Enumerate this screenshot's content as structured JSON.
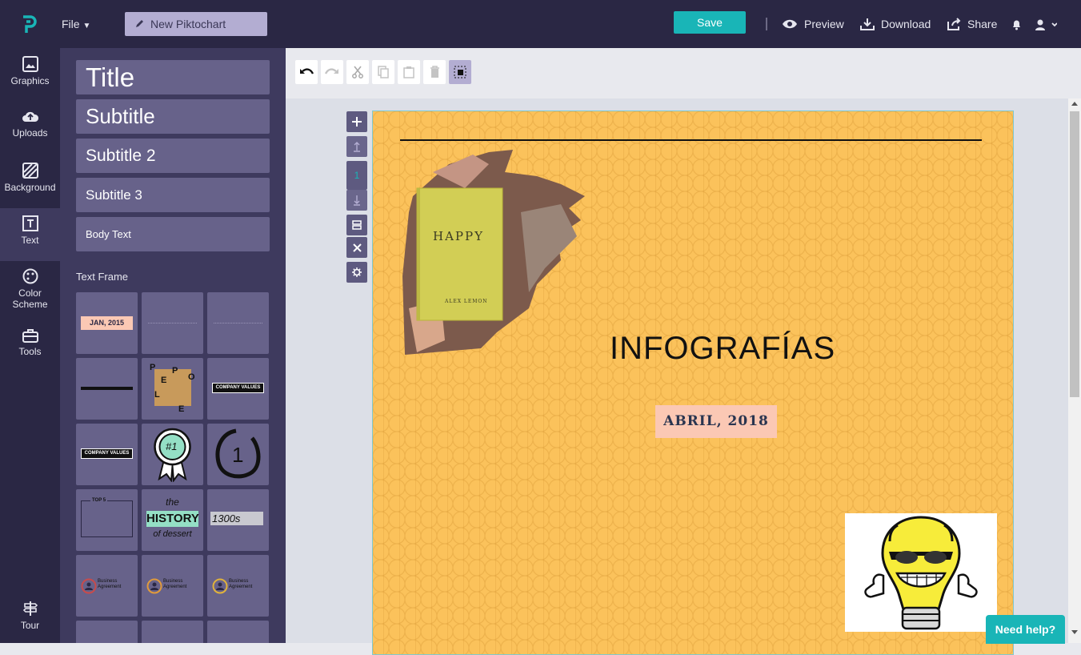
{
  "header": {
    "file_label": "File",
    "doc_title": "New Piktochart",
    "save_label": "Save",
    "preview_label": "Preview",
    "download_label": "Download",
    "share_label": "Share"
  },
  "rail": {
    "graphics": "Graphics",
    "uploads": "Uploads",
    "background": "Background",
    "text": "Text",
    "color1": "Color",
    "color2": "Scheme",
    "tools": "Tools",
    "tour": "Tour"
  },
  "panel": {
    "styles": [
      "Title",
      "Subtitle",
      "Subtitle 2",
      "Subtitle 3",
      "Body Text"
    ],
    "text_frame_heading": "Text Frame",
    "frames": {
      "jan": "JAN, 2015",
      "company_values": "COMPANY VALUES",
      "people": [
        "P",
        "E",
        "P",
        "O",
        "L",
        "E"
      ],
      "badge_num": "#1",
      "circle_num": "1",
      "top5": "TOP 5",
      "the": "the",
      "history": "HISTORY",
      "of_dessert": "of dessert",
      "year": "1300s",
      "biz1": "Business",
      "biz2": "Agreement"
    }
  },
  "page_controls": {
    "page_number": "1"
  },
  "canvas": {
    "heading": "INFOGRAFÍAS",
    "date_badge": "ABRIL, 2018",
    "book_title": "HAPPY",
    "book_author": "Alex Lemon"
  },
  "help_label": "Need help?",
  "colors": {
    "accent": "#19b5b7",
    "dark": "#2a2744",
    "panel": "#3e3a5e",
    "tile": "#67628a",
    "canvas_bg": "#fbc25b",
    "badge": "#fbc8b4"
  }
}
